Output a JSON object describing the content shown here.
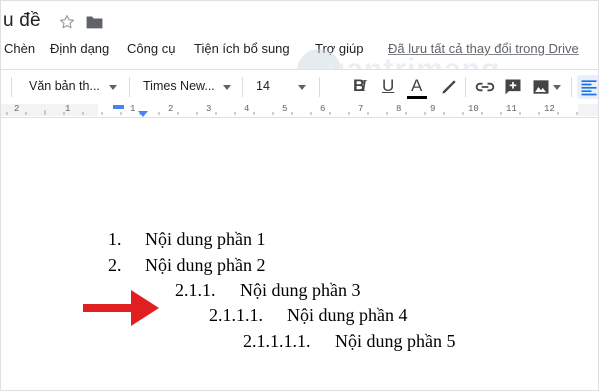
{
  "title_row": {
    "doc_title": "u đề",
    "icons": [
      "star-icon",
      "folder-icon"
    ]
  },
  "menu": {
    "items": [
      "Chèn",
      "Định dạng",
      "Công cụ",
      "Tiện ích bổ sung",
      "Trợ giúp"
    ],
    "saved_status": "Đã lưu tất cả thay đổi trong Drive"
  },
  "watermark": {
    "text": "uantrimang"
  },
  "toolbar": {
    "style_select": "Văn bản th...",
    "font_select": "Times New...",
    "size_select": "14",
    "bold": "B",
    "italic": "I",
    "underline": "U",
    "text_color": "A",
    "text_color_bar": "#000000",
    "icons": [
      "highlighter-icon",
      "link-icon",
      "add-comment-icon",
      "insert-image-icon",
      "align-left-icon"
    ]
  },
  "ruler": {
    "numbers": [
      "2",
      "1",
      "1",
      "2",
      "3",
      "4",
      "5",
      "6",
      "7",
      "8",
      "9",
      "10",
      "11",
      "12"
    ]
  },
  "document": {
    "list": [
      {
        "number": "1.",
        "text": "Nội dung phần 1"
      },
      {
        "number": "2.",
        "text": "Nội dung phần 2"
      },
      {
        "number": "2.1.1.",
        "text": "Nội dung phần 3"
      },
      {
        "number": "2.1.1.1.",
        "text": "Nội dung phần 4"
      },
      {
        "number": "2.1.1.1.1.",
        "text": "Nội dung phần 5"
      }
    ]
  },
  "annotation": {
    "arrow_color": "#e02020"
  }
}
